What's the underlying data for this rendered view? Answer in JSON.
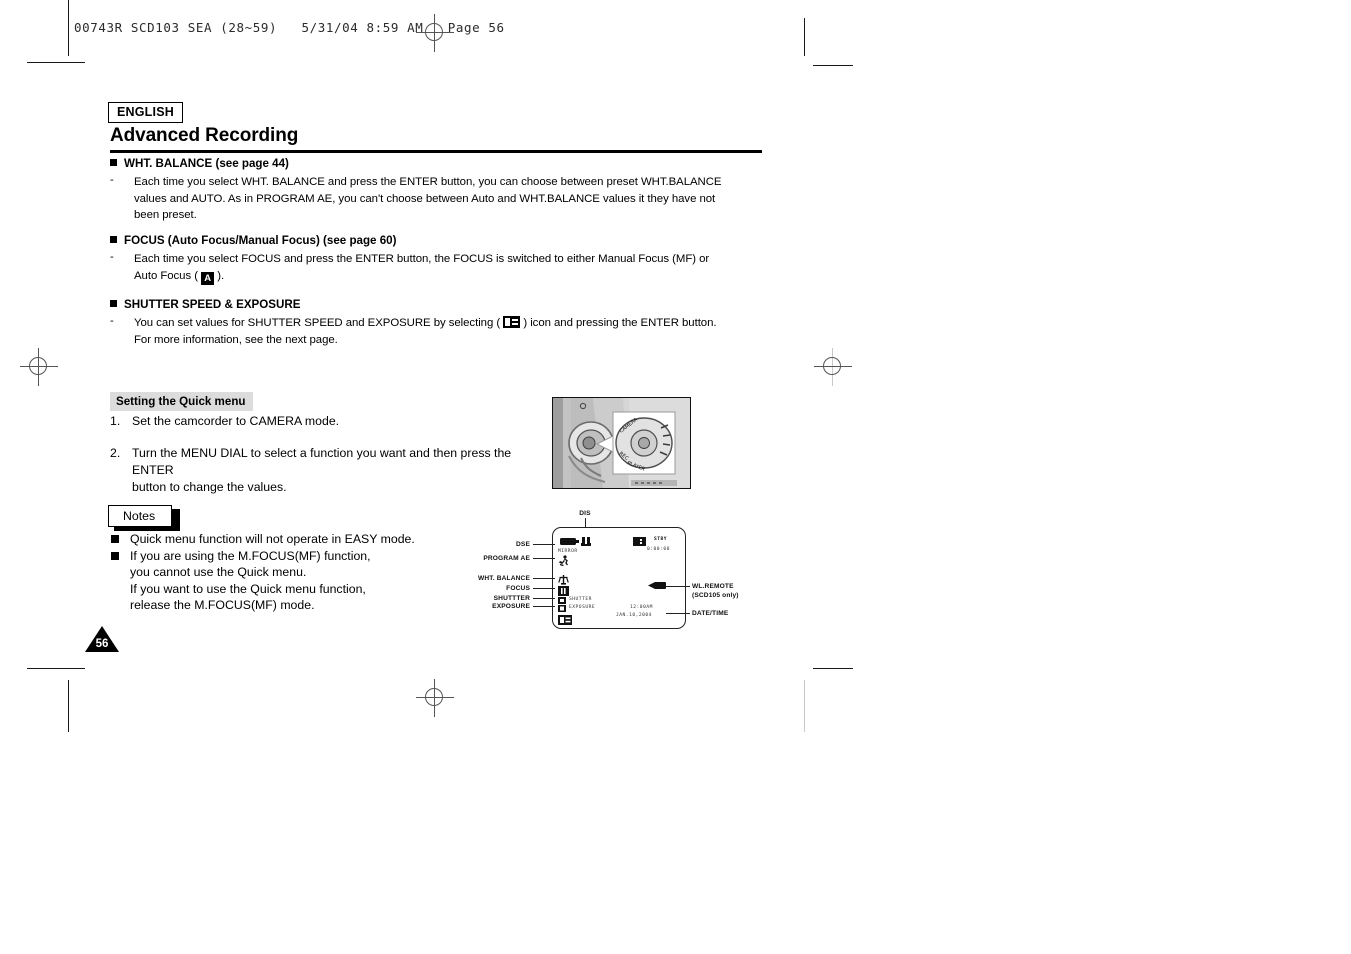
{
  "file_header": "00743R SCD103 SEA (28~59)   5/31/04 8:59 AM   Page 56",
  "language_tag": "ENGLISH",
  "page_title": "Advanced Recording",
  "page_number": "56",
  "sections": [
    {
      "heading": "WHT. BALANCE (see page 44)",
      "bullet": "-",
      "lines": [
        "Each time you select WHT. BALANCE and press the ENTER button, you can choose between preset WHT.BALANCE",
        "values and AUTO. As in PROGRAM AE, you can't choose between Auto and WHT.BALANCE values it they have not",
        "been preset."
      ]
    },
    {
      "heading": "FOCUS (Auto Focus/Manual Focus) (see page 60)",
      "bullet": "-",
      "lines": [
        "Each time you select FOCUS and press the ENTER button, the FOCUS is switched to either Manual Focus (MF) or",
        "Auto Focus ( [A] )."
      ],
      "line2_pre": "Auto Focus ( ",
      "line2_icon": "auto-focus-icon",
      "line2_post": " )."
    },
    {
      "heading": "SHUTTER SPEED & EXPOSURE",
      "bullet": "-",
      "lines": [
        "You can set values for SHUTTER SPEED and EXPOSURE by selecting ( [icon] ) icon and pressing the ENTER button.",
        "For more information, see the next page."
      ],
      "line1_pre": "You can set values for SHUTTER SPEED and EXPOSURE by selecting ( ",
      "line1_icon": "shutter-exposure-icon",
      "line1_post": " ) icon and pressing the ENTER button.",
      "line2": "For more information, see the next page."
    }
  ],
  "quick_menu": {
    "heading": "Setting the Quick menu",
    "steps": [
      {
        "num": "1.",
        "text": "Set the camcorder to CAMERA mode."
      },
      {
        "num": "2.",
        "line1": "Turn the MENU DIAL to select a function you want and then press the ENTER",
        "line2": "button to change the values."
      }
    ]
  },
  "notes": {
    "label": "Notes",
    "items": [
      {
        "lines": [
          "Quick menu function will not operate in EASY mode."
        ]
      },
      {
        "lines": [
          "If you are using the M.FOCUS(MF) function,",
          "you cannot use the Quick menu.",
          "If you want to use the Quick menu function,",
          "release the M.FOCUS(MF) mode."
        ]
      }
    ]
  },
  "camcorder_photo": {
    "dial_labels": [
      "CAMERA",
      "REC",
      "PLAYER"
    ]
  },
  "lcd_diagram": {
    "labels_top": [
      {
        "name": "DIS",
        "text": "DIS"
      }
    ],
    "labels_left": [
      {
        "name": "DSE",
        "text": "DSE"
      },
      {
        "name": "PROGRAM AE",
        "text": "PROGRAM AE"
      },
      {
        "name": "WHT. BALANCE",
        "text": "WHT. BALANCE"
      },
      {
        "name": "FOCUS",
        "text": "FOCUS"
      },
      {
        "name": "SHUTTTER",
        "text": "SHUTTTER"
      },
      {
        "name": "EXPOSURE",
        "text": "EXPOSURE"
      }
    ],
    "labels_right": [
      {
        "name": "WL.REMOTE",
        "text": "WL.REMOTE"
      },
      {
        "name": "SCD105 only",
        "text": "(SCD105 only)"
      },
      {
        "name": "DATE/TIME",
        "text": "DATE/TIME"
      }
    ],
    "screen_text": {
      "mirror": "MIRROR",
      "stby": "STBY",
      "timecode": "0:00:00",
      "shutter": "SHUTTER",
      "exposure": "EXPOSURE",
      "time": "12:00AM",
      "date": "JAN.10,2004"
    }
  },
  "colors": {
    "ink": "#000000",
    "gray_band": "#dcdcdc",
    "mark": "#555555"
  }
}
